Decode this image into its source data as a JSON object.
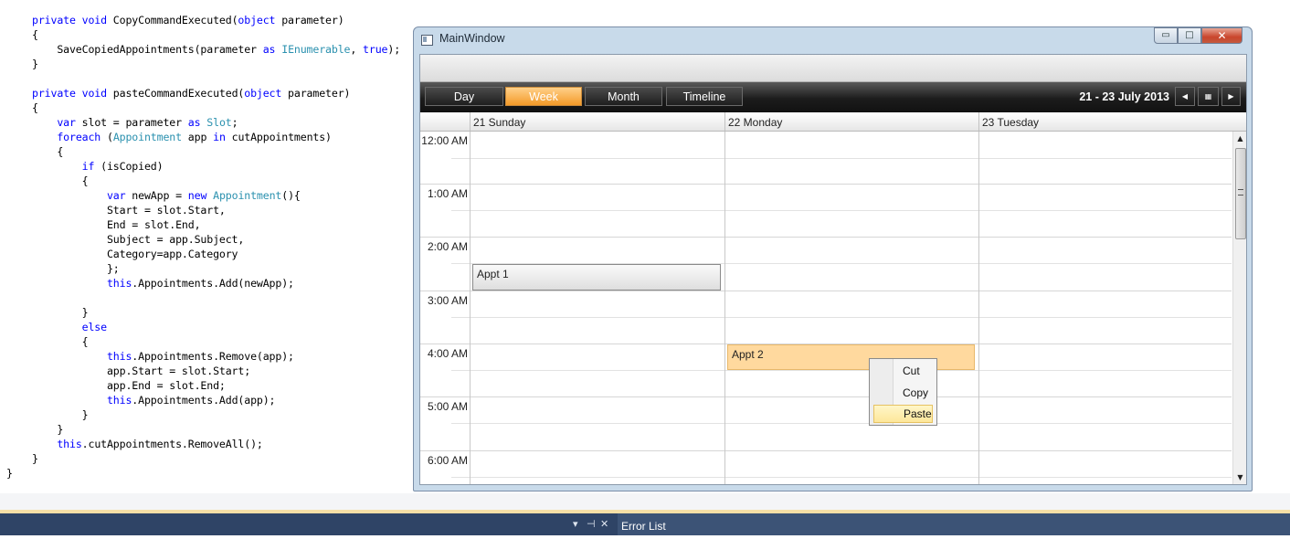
{
  "code_lines": [
    [
      {
        "t": "private void",
        "k": "kw"
      },
      {
        "t": " CopyCommandExecuted("
      },
      {
        "t": "object",
        "k": "kw"
      },
      {
        "t": " parameter)"
      }
    ],
    [
      {
        "t": "{"
      }
    ],
    [
      {
        "t": "    SaveCopiedAppointments(parameter "
      },
      {
        "t": "as",
        "k": "kw"
      },
      {
        "t": " "
      },
      {
        "t": "IEnumerable",
        "k": "ty"
      },
      {
        "t": ", "
      },
      {
        "t": "true",
        "k": "kw"
      },
      {
        "t": ");"
      }
    ],
    [
      {
        "t": "}"
      }
    ],
    [],
    [
      {
        "t": "private void",
        "k": "kw"
      },
      {
        "t": " pasteCommandExecuted("
      },
      {
        "t": "object",
        "k": "kw"
      },
      {
        "t": " parameter)"
      }
    ],
    [
      {
        "t": "{"
      }
    ],
    [
      {
        "t": "    "
      },
      {
        "t": "var",
        "k": "kw"
      },
      {
        "t": " slot = parameter "
      },
      {
        "t": "as",
        "k": "kw"
      },
      {
        "t": " "
      },
      {
        "t": "Slot",
        "k": "ty"
      },
      {
        "t": ";"
      }
    ],
    [
      {
        "t": "    "
      },
      {
        "t": "foreach",
        "k": "kw"
      },
      {
        "t": " ("
      },
      {
        "t": "Appointment",
        "k": "ty"
      },
      {
        "t": " app "
      },
      {
        "t": "in",
        "k": "kw"
      },
      {
        "t": " cutAppointments)"
      }
    ],
    [
      {
        "t": "    {"
      }
    ],
    [
      {
        "t": "        "
      },
      {
        "t": "if",
        "k": "kw"
      },
      {
        "t": " (isCopied)"
      }
    ],
    [
      {
        "t": "        {"
      }
    ],
    [
      {
        "t": "            "
      },
      {
        "t": "var",
        "k": "kw"
      },
      {
        "t": " newApp = "
      },
      {
        "t": "new",
        "k": "kw"
      },
      {
        "t": " "
      },
      {
        "t": "Appointment",
        "k": "ty"
      },
      {
        "t": "(){"
      }
    ],
    [
      {
        "t": "            Start = slot.Start,"
      }
    ],
    [
      {
        "t": "            End = slot.End,"
      }
    ],
    [
      {
        "t": "            Subject = app.Subject,"
      }
    ],
    [
      {
        "t": "            Category=app.Category"
      }
    ],
    [
      {
        "t": "            };"
      }
    ],
    [
      {
        "t": "            "
      },
      {
        "t": "this",
        "k": "kw"
      },
      {
        "t": ".Appointments.Add(newApp);"
      }
    ],
    [],
    [
      {
        "t": "        }"
      }
    ],
    [
      {
        "t": "        "
      },
      {
        "t": "else",
        "k": "kw"
      }
    ],
    [
      {
        "t": "        {"
      }
    ],
    [
      {
        "t": "            "
      },
      {
        "t": "this",
        "k": "kw"
      },
      {
        "t": ".Appointments.Remove(app);"
      }
    ],
    [
      {
        "t": "            app.Start = slot.Start;"
      }
    ],
    [
      {
        "t": "            app.End = slot.End;"
      }
    ],
    [
      {
        "t": "            "
      },
      {
        "t": "this",
        "k": "kw"
      },
      {
        "t": ".Appointments.Add(app);"
      }
    ],
    [
      {
        "t": "        }"
      }
    ],
    [
      {
        "t": "    }"
      }
    ],
    [
      {
        "t": "    "
      },
      {
        "t": "this",
        "k": "kw"
      },
      {
        "t": ".cutAppointments.RemoveAll();"
      }
    ],
    [
      {
        "t": "}"
      }
    ],
    [
      {
        "t": "}"
      }
    ]
  ],
  "window": {
    "title": "MainWindow",
    "min_glyph": "▭",
    "max_glyph": "□",
    "close_glyph": "✕",
    "icon": "window-icon"
  },
  "views": [
    "Day",
    "Week",
    "Month",
    "Timeline"
  ],
  "active_view": "Week",
  "date_range": "21  - 23 July 2013",
  "nav": {
    "prev": "◀",
    "calendar": "▦",
    "next": "▶"
  },
  "days": [
    "21 Sunday",
    "22 Monday",
    "23 Tuesday"
  ],
  "times": [
    "12:00 AM",
    "1:00 AM",
    "2:00 AM",
    "3:00 AM",
    "4:00 AM",
    "5:00 AM",
    "6:00 AM"
  ],
  "appointments": [
    {
      "subject": "Appt 1",
      "day": "21 Sunday",
      "start": "2:30 AM",
      "selected": false
    },
    {
      "subject": "Appt 2",
      "day": "22 Monday",
      "start": "4:00 AM",
      "selected": true
    }
  ],
  "context_menu": {
    "items": [
      "Cut",
      "Copy",
      "Paste"
    ],
    "highlighted": "Paste"
  },
  "scrollbar": {
    "up": "▲",
    "down": "▼",
    "grip": "≡"
  },
  "error_bar": {
    "title": "Error List",
    "dropdown": "▾",
    "pin": "⊣",
    "close": "✕"
  },
  "colors": {
    "accent_orange": "#f49a28",
    "appt_selected": "#ffd99e",
    "highlight": "#fde79a",
    "keyword": "#0000ff",
    "type": "#2b91af"
  }
}
